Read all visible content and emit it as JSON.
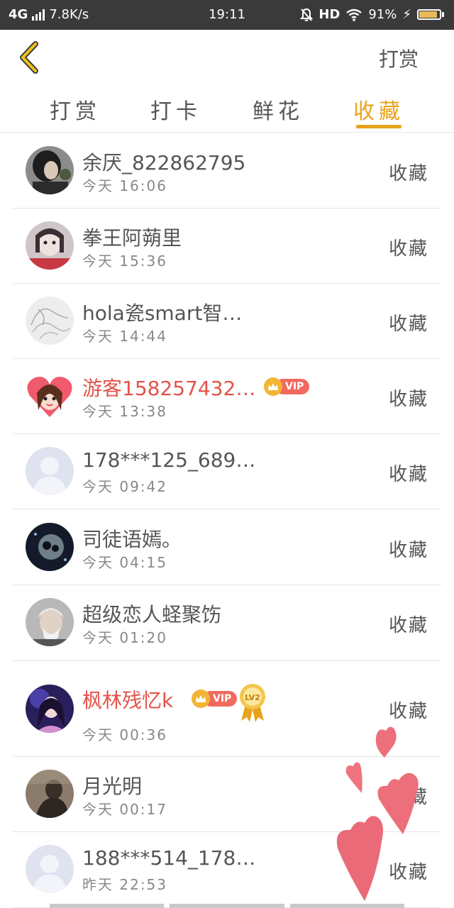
{
  "status_bar": {
    "network": "4G",
    "speed": "7.8K/s",
    "time": "19:11",
    "hd": "HD",
    "battery_pct": "91%",
    "battery_level": 0.91
  },
  "header": {
    "back_icon": "chevron-left-icon",
    "title": "打赏"
  },
  "tabs": [
    {
      "label": "打赏",
      "active": false
    },
    {
      "label": "打卡",
      "active": false
    },
    {
      "label": "鲜花",
      "active": false
    },
    {
      "label": "收藏",
      "active": true
    }
  ],
  "colors": {
    "accent": "#e9a21b",
    "vip_name": "#e2534a",
    "statusbar": "#3a3a3a"
  },
  "list": [
    {
      "name": "余厌_822862795",
      "time": "今天 16:06",
      "action": "收藏",
      "vip": false
    },
    {
      "name": "拳王阿蒴里",
      "time": "今天 15:36",
      "action": "收藏",
      "vip": false
    },
    {
      "name": "hola瓷smart智…",
      "time": "今天 14:44",
      "action": "收藏",
      "vip": false
    },
    {
      "name": "游客158257432…",
      "time": "今天 13:38",
      "action": "收藏",
      "vip": true,
      "vip_label": "VIP"
    },
    {
      "name": "178***125_689…",
      "time": "今天 09:42",
      "action": "收藏",
      "vip": false
    },
    {
      "name": "司徒语嫣。",
      "time": "今天 04:15",
      "action": "收藏",
      "vip": false
    },
    {
      "name": "超级恋人蛏聚饬",
      "time": "今天 01:20",
      "action": "收藏",
      "vip": false
    },
    {
      "name": "枫林残忆k",
      "time": "今天 00:36",
      "action": "收藏",
      "vip": true,
      "vip_label": "VIP",
      "medal_label": "LV2"
    },
    {
      "name": "月光明",
      "time": "今天 00:17",
      "action": "收藏",
      "vip": false
    },
    {
      "name": "188***514_178…",
      "time": "昨天 22:53",
      "action": "收藏",
      "vip": false
    }
  ]
}
